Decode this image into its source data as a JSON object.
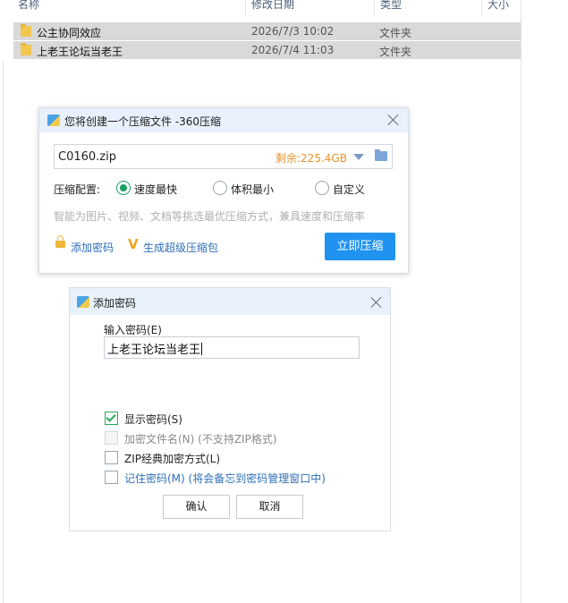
{
  "explorer": {
    "columns": {
      "name": "名称",
      "date": "修改日期",
      "type": "类型",
      "size": "大小"
    },
    "rows": [
      {
        "name": "公主协同效应",
        "date": "2026/7/3 10:02",
        "type": "文件夹"
      },
      {
        "name": "上老王论坛当老王",
        "date": "2026/7/4 11:03",
        "type": "文件夹"
      }
    ]
  },
  "compress_dialog": {
    "title": "您将创建一个压缩文件 -360压缩",
    "filename": "C0160.zip",
    "free_space": "剩余:225.4GB",
    "config_label": "压缩配置:",
    "options": [
      "速度最快",
      "体积最小",
      "自定义"
    ],
    "selected_option": "速度最快",
    "hint": "智能为图片、视频、文档等挑选最优压缩方式，兼具速度和压缩率",
    "add_password": "添加密码",
    "super_pack": "生成超级压缩包",
    "compress_button": "立即压缩",
    "accent_color": "#1f93ef"
  },
  "password_dialog": {
    "title": "添加密码",
    "input_label": "输入密码(E)",
    "password_value": "上老王论坛当老王",
    "checkboxes": [
      {
        "label": "显示密码(S)",
        "checked": true,
        "enabled": true
      },
      {
        "label": "加密文件名(N) (不支持ZIP格式)",
        "checked": false,
        "enabled": false
      },
      {
        "label": "ZIP经典加密方式(L)",
        "checked": false,
        "enabled": true
      },
      {
        "label": "记住密码(M) (将会备忘到密码管理窗口中)",
        "checked": false,
        "enabled": true
      }
    ],
    "ok_button": "确认",
    "cancel_button": "取消"
  }
}
